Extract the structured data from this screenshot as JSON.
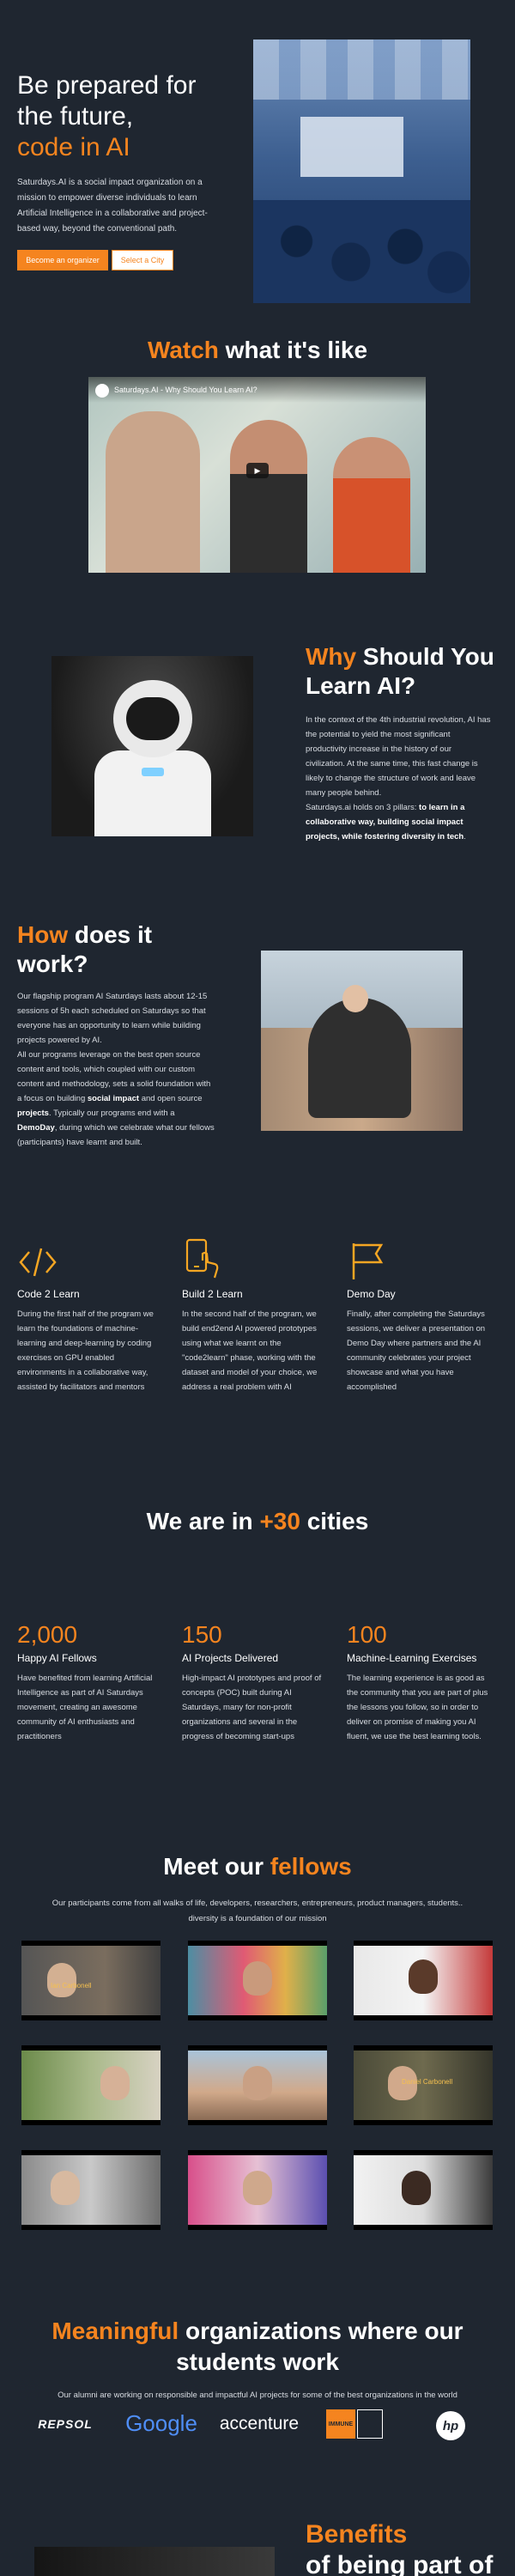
{
  "hero": {
    "title_line1": "Be prepared for",
    "title_line2": "the future,",
    "title_accent": "code in AI",
    "description": "Saturdays.AI is a social impact organization on a mission to empower diverse individuals to learn Artificial Intelligence in a collaborative and project-based way, beyond the conventional path.",
    "btn_organizer": "Become an organizer",
    "btn_city": "Select a City"
  },
  "watch": {
    "accent": "Watch",
    "rest": " what it's like",
    "video_title": "Saturdays.AI - Why Should You Learn AI?"
  },
  "why": {
    "accent": "Why",
    "rest": " Should You Learn AI?",
    "p1": "In the context of the 4th industrial revolution, AI has the potential to yield the most significant productivity increase in the history of our civilization. At the same time, this fast change is likely to change the structure of work and leave many people behind.",
    "p2_start": "Saturdays.ai holds on 3 pillars: ",
    "p2_bold": "to learn in a collaborative way, building social impact projects, while fostering diversity in tech",
    "p2_end": "."
  },
  "how": {
    "accent": "How",
    "rest": " does it work?",
    "p1": "Our flagship program AI Saturdays lasts about 12-15 sessions of 5h each scheduled on Saturdays so that everyone has an opportunity to learn while building projects powered by AI.",
    "p2_a": "All our programs leverage on the best open source content and tools, which coupled with our custom content and methodology, sets a solid foundation with a focus on building ",
    "p2_b1": "social impact",
    "p2_c": " and open source ",
    "p2_b2": "projects",
    "p2_d": ". Typically our programs end with a ",
    "p2_b3": "DemoDay",
    "p2_e": ", during which we celebrate what our fellows (participants) have learnt and built."
  },
  "phases": [
    {
      "icon": "code-icon",
      "title": "Code 2 Learn",
      "text": "During the first half of the program we learn the foundations of machine-learning and deep-learning by coding exercises on GPU enabled environments in a collaborative way, assisted by facilitators and mentors"
    },
    {
      "icon": "phone-touch-icon",
      "title": "Build 2 Learn",
      "text": "In the second half of the program, we build end2end AI powered prototypes using what we learnt on the \"code2learn\" phase, working with the dataset and model of your choice, we address a real problem with AI"
    },
    {
      "icon": "flag-icon",
      "title": "Demo Day",
      "text": "Finally, after completing the Saturdays sessions, we deliver a presentation on Demo Day where partners and the AI community celebrates your project showcase and what you have accomplished"
    }
  ],
  "cities": {
    "prefix": "We are in ",
    "accent": "+30",
    "suffix": " cities"
  },
  "stats": [
    {
      "number": "2,000",
      "label": "Happy AI Fellows",
      "text": "Have benefited from learning Artificial Intelligence as part of AI Saturdays movement, creating an awesome community of AI enthusiasts and practitioners"
    },
    {
      "number": "150",
      "label": "AI Projects Delivered",
      "text": "High-impact AI prototypes and proof of concepts (POC) built during AI Saturdays, many for non-profit organizations and several in the progress of becoming start-ups"
    },
    {
      "number": "100",
      "label": "Machine-Learning Exercises",
      "text": "The learning experience is as good as the community that you are part of plus the lessons you follow, so in order to deliver on promise of making you AI fluent, we use the best learning tools."
    }
  ],
  "fellows": {
    "prefix": "Meet our ",
    "accent": "fellows",
    "description": "Our participants come from all walks of life, developers, researchers, entrepreneurs, product managers, students.. diversity is a foundation of our mission",
    "caption1": "Ian Carbonell",
    "caption6": "Daniel Carbonell"
  },
  "orgs": {
    "accent": "Meaningful",
    "rest": " organizations where our students work",
    "description": "Our alumni are working on responsible and impactful AI projects for some of the best organizations in the world",
    "logos": [
      "REPSOL",
      "Google",
      "accenture",
      "IMMUNE",
      "hp"
    ]
  },
  "benefits": {
    "accent": "Benefits",
    "rest": " of being part of"
  },
  "colors": {
    "accent": "#f5841f",
    "background": "#1f2630"
  }
}
